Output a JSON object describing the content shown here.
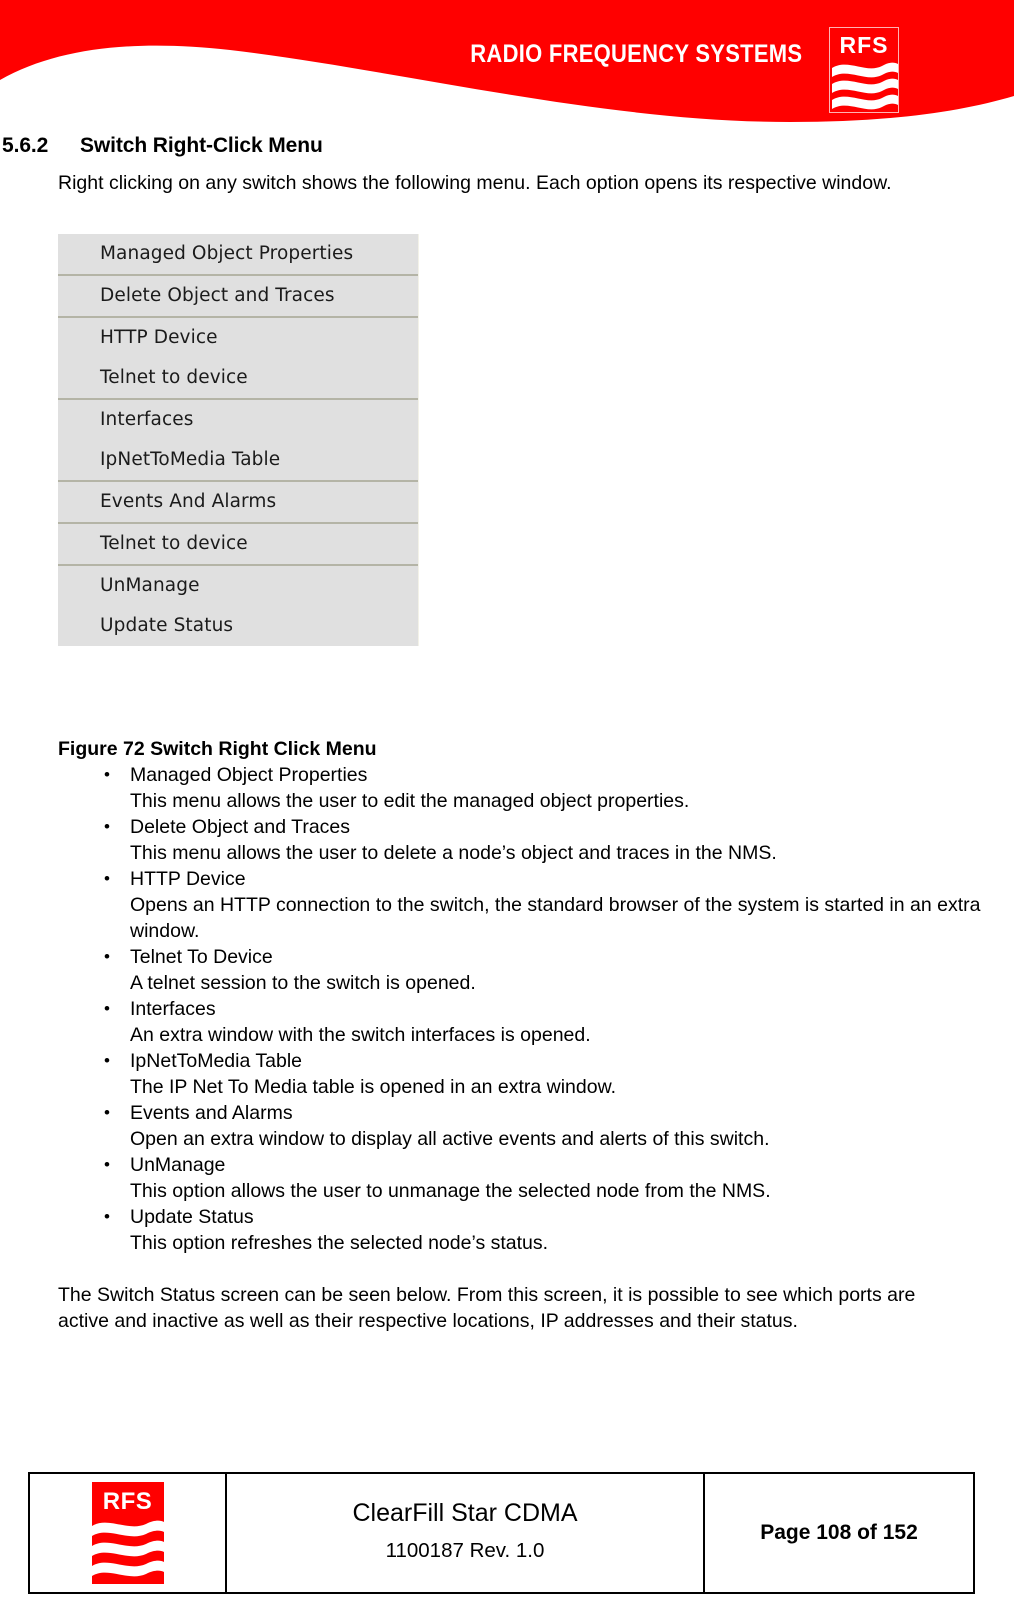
{
  "header": {
    "brand_name": "RADIO FREQUENCY SYSTEMS",
    "logo_letters": "RFS",
    "banner_color": "#ff0000"
  },
  "section": {
    "number": "5.6.2",
    "title": "Switch Right-Click Menu",
    "intro": "Right clicking on any switch shows the following menu. Each option opens its respective window."
  },
  "context_menu": {
    "groups": [
      {
        "items": [
          "Managed Object Properties"
        ]
      },
      {
        "items": [
          "Delete Object and Traces"
        ]
      },
      {
        "items": [
          "HTTP Device",
          "Telnet to device"
        ]
      },
      {
        "items": [
          "Interfaces",
          "IpNetToMedia Table"
        ]
      },
      {
        "items": [
          "Events And Alarms"
        ]
      },
      {
        "items": [
          "Telnet to device"
        ]
      },
      {
        "items": [
          "UnManage",
          "Update Status"
        ]
      }
    ]
  },
  "figure": {
    "caption": "Figure 72 Switch Right Click Menu"
  },
  "options": [
    {
      "bullet": "•",
      "name": "Managed Object Properties",
      "description": "This menu allows the user to edit the managed object properties."
    },
    {
      "bullet": "•",
      "name": "Delete Object and Traces",
      "description": "This menu allows the user to delete a node’s object and traces in the NMS."
    },
    {
      "bullet": "•",
      "name": "HTTP Device",
      "description": "Opens an HTTP connection to the switch, the standard browser of the system is started in an extra window."
    },
    {
      "bullet": "•",
      "name": "Telnet To Device",
      "description": "A telnet session to the switch is opened."
    },
    {
      "bullet": "•",
      "name": "Interfaces",
      "description": "An extra window with the switch interfaces is opened."
    },
    {
      "bullet": "•",
      "name": "IpNetToMedia Table",
      "description": "The IP Net To Media table is opened in an extra window."
    },
    {
      "bullet": "•",
      "name": "Events and Alarms",
      "description": "Open an extra window to display all active events and alerts of this switch."
    },
    {
      "bullet": "•",
      "name": "UnManage",
      "description": "This option allows the user to unmanage the selected node from the NMS."
    },
    {
      "bullet": "•",
      "name": "Update Status",
      "description": "This option refreshes the selected node’s status."
    }
  ],
  "closing_paragraph": "The Switch Status screen can be seen below. From this screen, it is possible to see which ports are active and inactive as well as their respective locations, IP addresses and their status.",
  "footer": {
    "logo_letters": "RFS",
    "title": "ClearFill Star CDMA",
    "revision": "1100187 Rev. 1.0",
    "page": "Page 108 of 152"
  }
}
